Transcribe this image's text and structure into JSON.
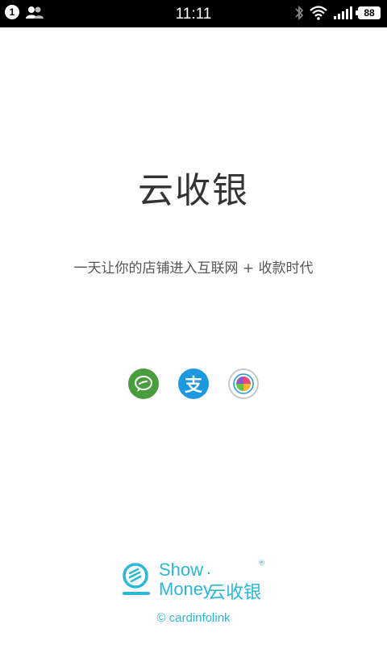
{
  "status_bar": {
    "notification_count": "1",
    "time": "11:11",
    "battery": "88",
    "icons": [
      "contacts-icon",
      "bluetooth-icon",
      "wifi-icon",
      "signal-icon",
      "battery-icon"
    ]
  },
  "main": {
    "app_title": "云收银",
    "tagline": "一天让你的店铺进入互联网 + 收款时代",
    "payment_methods": [
      "wechat-pay-icon",
      "alipay-icon",
      "qq-wallet-icon"
    ],
    "alipay_glyph": "支"
  },
  "brand": {
    "show": "Show",
    "dot": ".",
    "money": "Money",
    "cn_name": "云收银",
    "registered": "®",
    "copyright": "© cardinfolink"
  },
  "colors": {
    "brand": "#2ab7d8",
    "wechat": "#4a9d3e",
    "alipay": "#1c98e0"
  }
}
